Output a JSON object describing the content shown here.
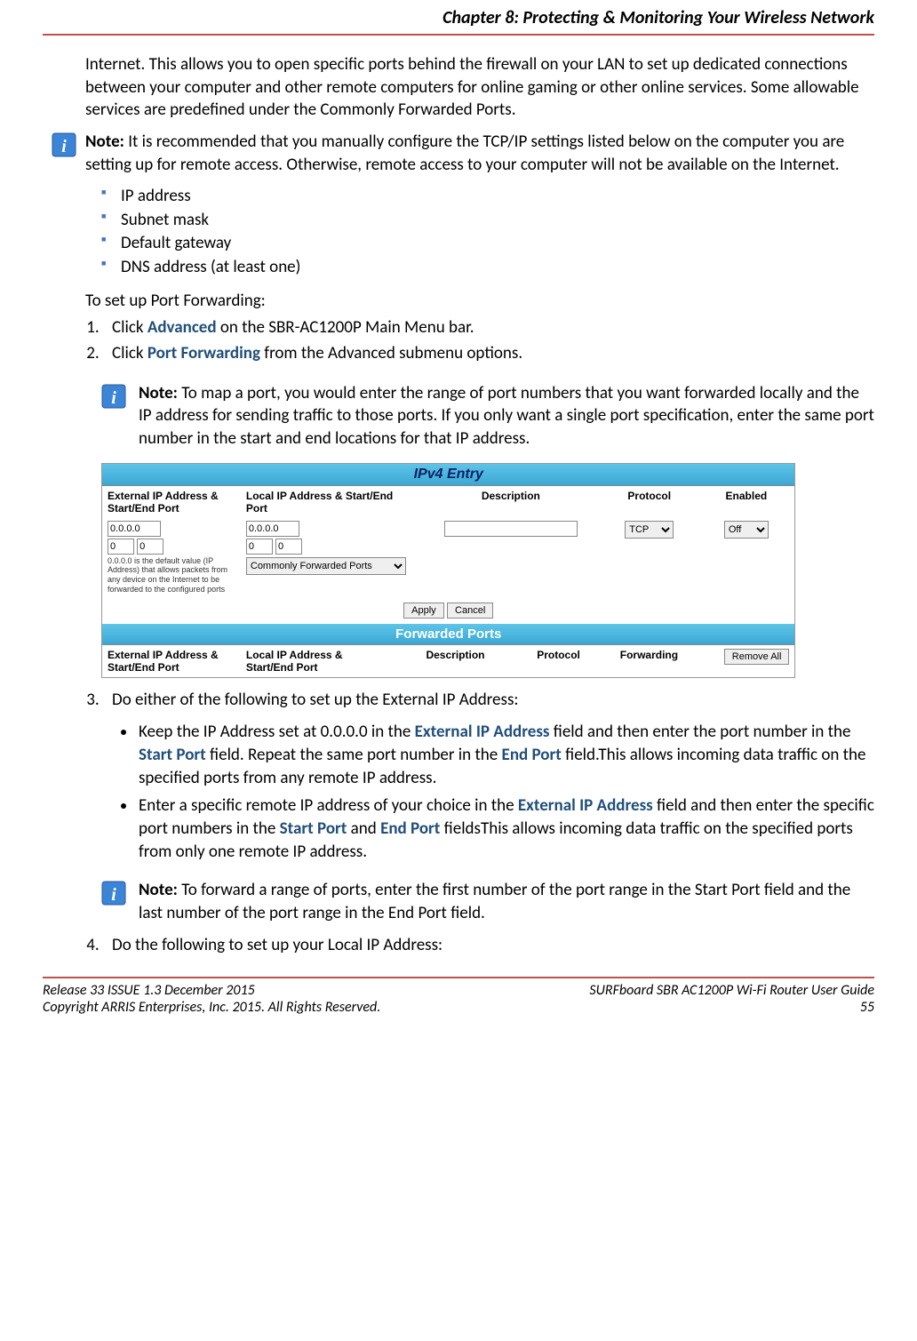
{
  "header": {
    "title": "Chapter 8: Protecting & Monitoring Your Wireless Network"
  },
  "body": {
    "intro": "Internet. This allows you to open specific ports behind the firewall on your LAN to set up dedicated connections between your computer and other remote computers for online gaming or other online services. Some allowable services are predefined under the Commonly Forwarded Ports.",
    "note1_label": "Note:",
    "note1_text": " It is recommended that you manually configure the TCP/IP settings listed below on the computer you are setting up for remote access. Otherwise, remote access to your computer will not be available on the Internet.",
    "settings_list": [
      "IP address",
      "Subnet mask",
      "Default gateway",
      "DNS address (at least one)"
    ],
    "setup_heading": "To set up Port Forwarding:",
    "step1_pre": "Click ",
    "step1_link": "Advanced",
    "step1_post": " on the SBR-AC1200P Main Menu bar.",
    "step2_pre": "Click ",
    "step2_link": "Port Forwarding",
    "step2_post": " from the Advanced submenu options.",
    "note2_label": "Note:",
    "note2_text": " To map a port, you would enter the range of port numbers that you want forwarded locally and the IP address for sending traffic to those ports. If you only want a single port specification, enter the same port number in the start and end locations for that IP address.",
    "step3_text": "Do either of the following to set up the External IP Address:",
    "b1_pre": "Keep the IP Address set at 0.0.0.0 in the ",
    "b1_l1": "External IP Address",
    "b1_mid1": " field and then enter the port number in the ",
    "b1_l2": "Start Port",
    "b1_mid2": " field. Repeat the same port number in the ",
    "b1_l3": "End Port",
    "b1_post": " field.This allows incoming data traffic on the specified ports from any remote IP address.",
    "b2_pre": "Enter a specific remote IP address of your choice in the ",
    "b2_l1": "External IP Address",
    "b2_mid1": " field and then enter the specific port numbers in the ",
    "b2_l2": "Start Port",
    "b2_mid2": " and ",
    "b2_l3": "End Port",
    "b2_post": " fieldsThis allows incoming data traffic on the specified ports from only one remote IP address.",
    "note3_label": "Note:",
    "note3_text": " To forward a range of ports, enter the first number of the port range in the Start Port field and the last number of the port range in the End Port field.",
    "step4_text": "Do the following to set up your Local IP Address:"
  },
  "screenshot": {
    "section1": "IPv4 Entry",
    "col_ext": "External IP Address & Start/End Port",
    "col_loc": "Local IP Address & Start/End Port",
    "col_desc": "Description",
    "col_proto": "Protocol",
    "col_enabled": "Enabled",
    "ip_default": "0.0.0.0",
    "port_default": "0",
    "hint": "0.0.0.0 is the default value (IP Address) that allows packets from any device on the Internet to be forwarded to the configured ports",
    "cfp": "Commonly Forwarded Ports",
    "proto_val": "TCP",
    "enabled_val": "Off",
    "apply": "Apply",
    "cancel": "Cancel",
    "section2": "Forwarded Ports",
    "col_ext2": "External IP Address & Start/End Port",
    "col_loc2": "Local IP Address & Start/End Port",
    "col_desc2": "Description",
    "col_proto2": "Protocol",
    "col_fwd": "Forwarding",
    "remove_all": "Remove All"
  },
  "footer": {
    "left1": "Release 33 ISSUE 1.3    December 2015",
    "left2": "Copyright ARRIS Enterprises, Inc. 2015. All Rights Reserved.",
    "right1": "SURFboard SBR AC1200P Wi-Fi Router User Guide",
    "right2": "55"
  }
}
